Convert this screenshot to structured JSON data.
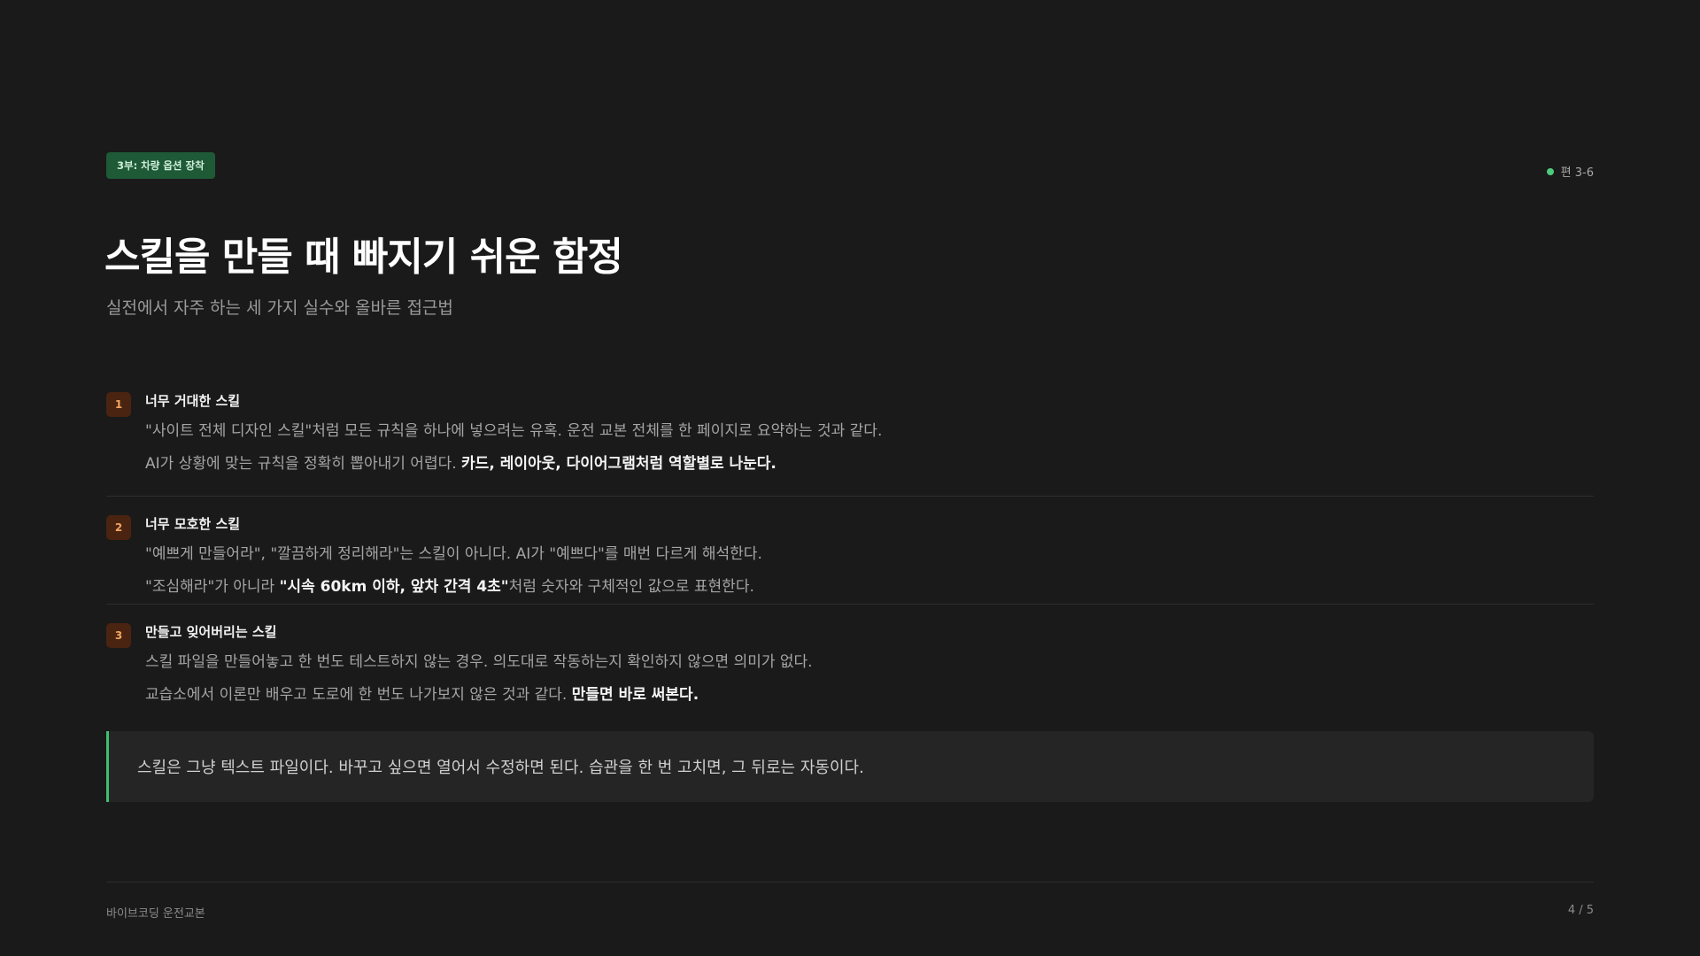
{
  "header": {
    "chapter_tag": "3부: 차량 옵션 장착",
    "episode": "편 3-6",
    "status_dot_color": "#4ecb7c"
  },
  "title": "스킬을 만들 때 빠지기 쉬운 함정",
  "subtitle": "실전에서 자주 하는 세 가지 실수와 올바른 접근법",
  "items": [
    {
      "number": "1",
      "title": "너무 거대한 스킬",
      "line1": "\"사이트 전체 디자인 스킬\"처럼 모든 규칙을 하나에 넣으려는 유혹. 운전 교본 전체를 한 페이지로 요약하는 것과 같다.",
      "line2_pre": "AI가 상황에 맞는 규칙을 정확히 뽑아내기 어렵다. ",
      "line2_bold": "카드, 레이아웃, 다이어그램처럼 역할별로 나눈다.",
      "line2_post": ""
    },
    {
      "number": "2",
      "title": "너무 모호한 스킬",
      "line1": "\"예쁘게 만들어라\", \"깔끔하게 정리해라\"는 스킬이 아니다. AI가 \"예쁘다\"를 매번 다르게 해석한다.",
      "line2_pre": "\"조심해라\"가 아니라 ",
      "line2_bold": "\"시속 60km 이하, 앞차 간격 4초\"",
      "line2_post": "처럼 숫자와 구체적인 값으로 표현한다."
    },
    {
      "number": "3",
      "title": "만들고 잊어버리는 스킬",
      "line1": "스킬 파일을 만들어놓고 한 번도 테스트하지 않는 경우. 의도대로 작동하는지 확인하지 않으면 의미가 없다.",
      "line2_pre": "교습소에서 이론만 배우고 도로에 한 번도 나가보지 않은 것과 같다. ",
      "line2_bold": "만들면 바로 써본다.",
      "line2_post": ""
    }
  ],
  "callout": "스킬은 그냥 텍스트 파일이다. 바꾸고 싶으면 열어서 수정하면 된다. 습관을 한 번 고치면, 그 뒤로는 자동이다.",
  "footer": {
    "left": "바이브코딩 운전교본",
    "page": "4 / 5"
  },
  "colors": {
    "background": "#1a1a1a",
    "accent_green": "#3fbf6e",
    "number_badge_bg": "#4a2410",
    "number_badge_fg": "#f1a662"
  }
}
